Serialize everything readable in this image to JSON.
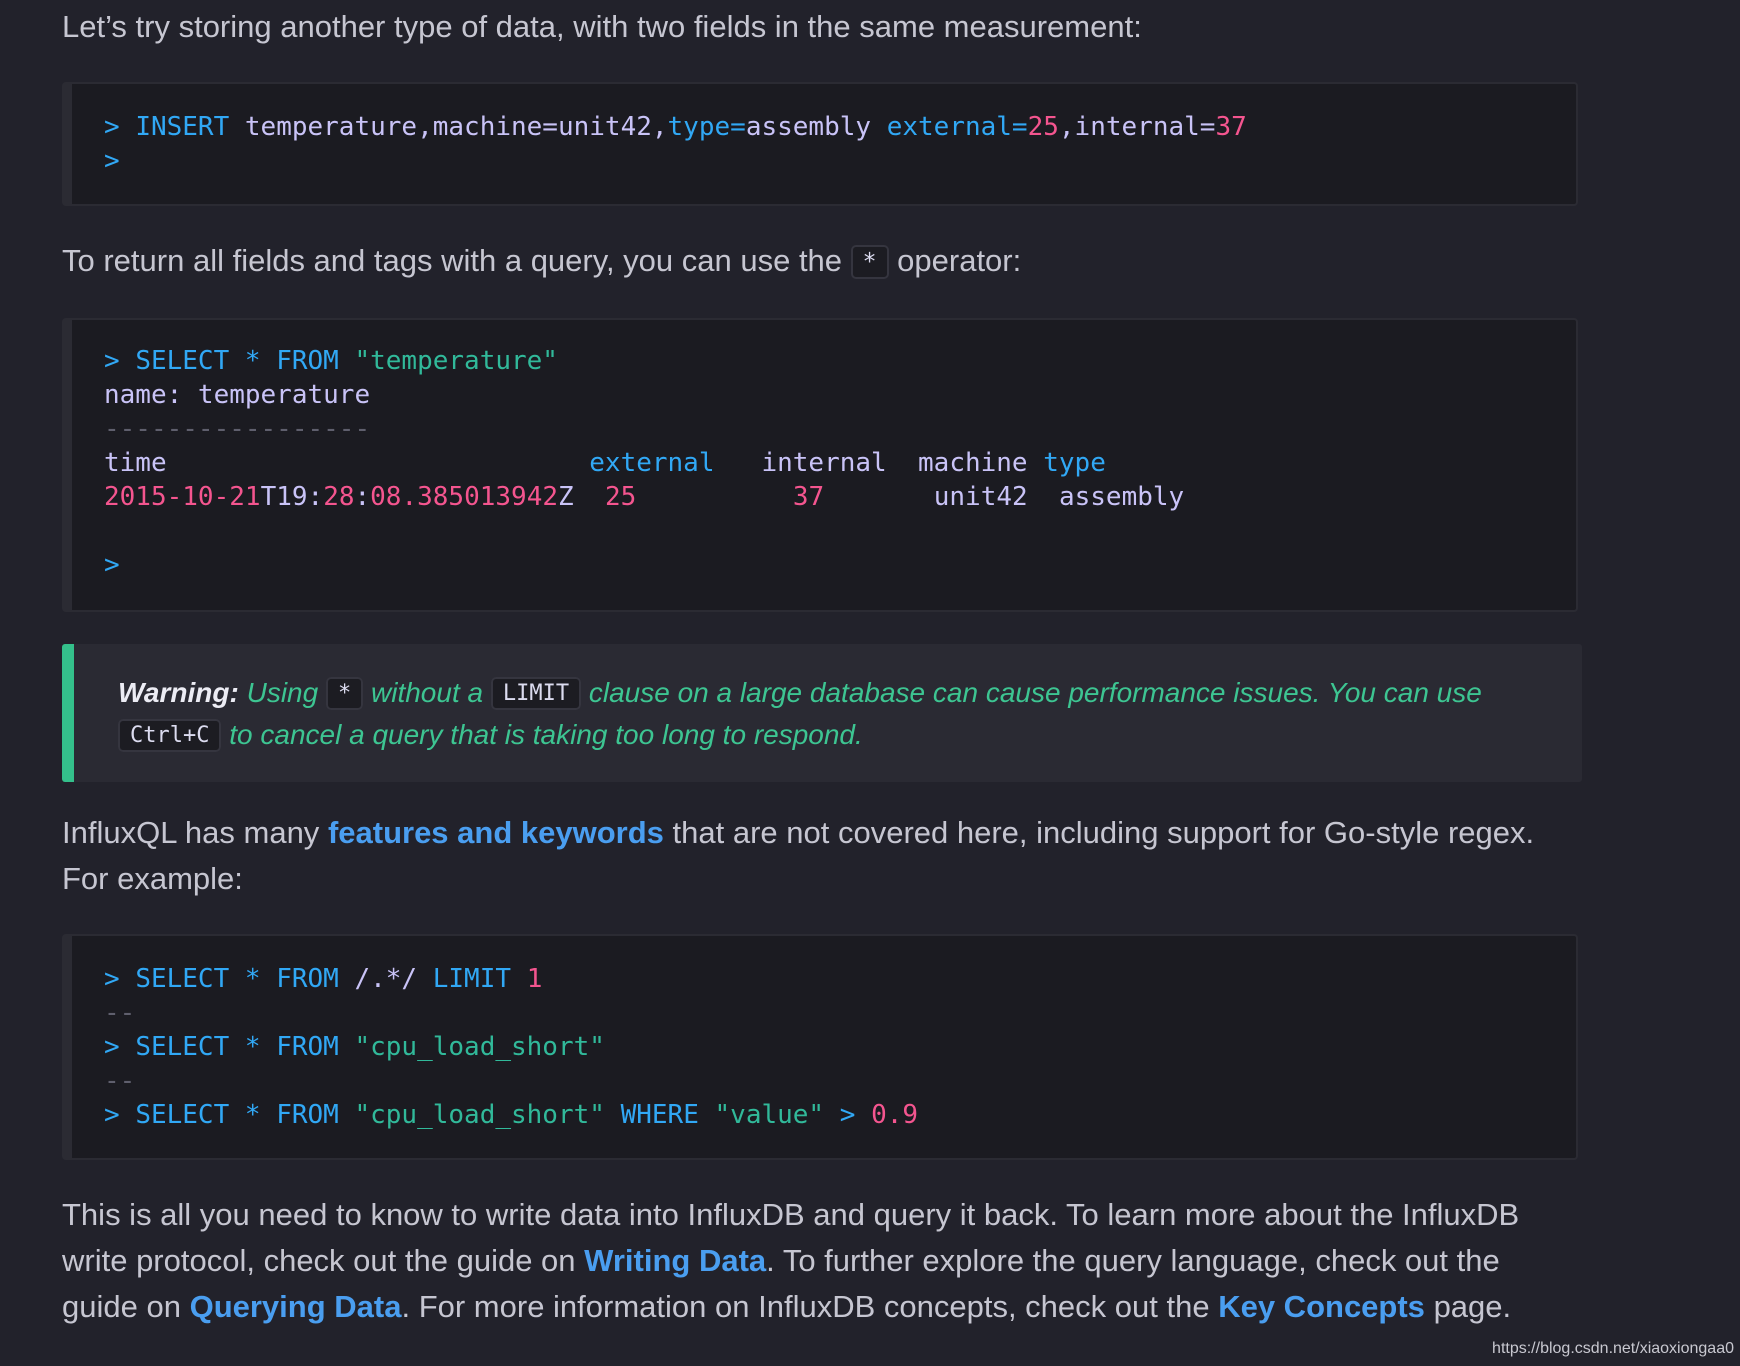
{
  "intro_text": "Let’s try storing another type of data, with two fields in the same measurement:",
  "code1": {
    "line1": {
      "prompt": ">",
      "keyword": "INSERT",
      "measurement": "temperature,machine=unit42,",
      "tag_key": "type=",
      "tag_val": "assembly",
      "field1_key": "external=",
      "field1_val": "25",
      "comma": ",internal=",
      "field2_val": "37"
    },
    "line2_prompt": ">"
  },
  "para2": {
    "before": "To return all fields and tags with a query, you can use the",
    "code": "*",
    "after": "operator:"
  },
  "code2": {
    "prompt": ">",
    "select": "SELECT * FROM",
    "measurement_str": "\"temperature\"",
    "name_line": "name: temperature",
    "separator": "-----------------",
    "columns": {
      "time": "time",
      "external": "external",
      "internal": "internal",
      "machine": "machine",
      "type": "type"
    },
    "row": {
      "date_a": "2015",
      "date_sep1": "-",
      "date_b": "10",
      "date_sep2": "-",
      "date_c": "21",
      "date_t": "T",
      "h": "19",
      "m": "28",
      "s": "08",
      "frac": ".385013942",
      "z": "Z",
      "external": "25",
      "internal": "37",
      "machine": "unit42",
      "type": "assembly"
    },
    "end_prompt": ">"
  },
  "warning": {
    "label": "Warning:",
    "t1": "Using",
    "c1": "*",
    "t2": "without a",
    "c2": "LIMIT",
    "t3": "clause on a large database can cause performance issues. You can use",
    "c3": "Ctrl+C",
    "t4": "to cancel a query that is taking too long to respond."
  },
  "para3": {
    "before": "InfluxQL has many",
    "link": "features and keywords",
    "after": "that are not covered here, including support for Go-style regex.",
    "line2": "For example:"
  },
  "code3": {
    "l1_prompt": ">",
    "l1_kw": "SELECT * FROM",
    "l1_regex": "/.*/",
    "l1_limit": "LIMIT",
    "l1_num": "1",
    "sep": "--",
    "l2_prompt": ">",
    "l2_kw": "SELECT * FROM",
    "l2_str": "\"cpu_load_short\"",
    "l3_prompt": ">",
    "l3_kw": "SELECT * FROM",
    "l3_str": "\"cpu_load_short\"",
    "l3_where": "WHERE",
    "l3_field": "\"value\"",
    "l3_op": ">",
    "l3_num": "0.9"
  },
  "para4": {
    "t1": "This is all you need to know to write data into InfluxDB and query it back. To learn more about the InfluxDB write protocol, check out the guide on",
    "link1": "Writing Data",
    "t2": ". To further explore the query language, check out the guide on",
    "link2": "Querying Data",
    "t3": ". For more information on InfluxDB concepts, check out the",
    "link3": "Key Concepts",
    "t4": "page."
  },
  "footer_url": "https://blog.csdn.net/xiaoxiongaa0"
}
